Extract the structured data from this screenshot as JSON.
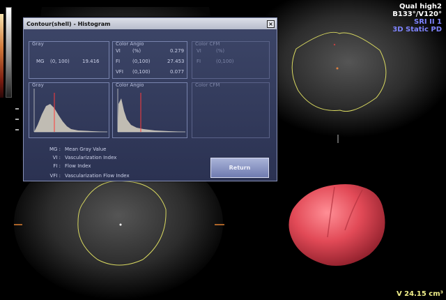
{
  "dialog": {
    "title": "Contour(shell) - Histogram",
    "close_label": "×",
    "gray_panel": {
      "title": "Gray",
      "mg_label": "MG",
      "mg_range": "(0, 100)",
      "mg_value": "19.416"
    },
    "angio_panel": {
      "title": "Color Angio",
      "vi_label": "VI",
      "vi_range": "(%)",
      "vi_value": "0.279",
      "fi_label": "FI",
      "fi_range": "(0,100)",
      "fi_value": "27.453",
      "vfi_label": "VFI",
      "vfi_range": "(0,100)",
      "vfi_value": "0.077"
    },
    "cfm_panel": {
      "title": "Color CFM",
      "vi_label": "VI",
      "vi_range": "(%)",
      "fi_label": "FI",
      "fi_range": "(0,100)"
    },
    "hist_gray_title": "Gray",
    "hist_angio_title": "Color Angio",
    "hist_cfm_title": "Color CFM",
    "legend": [
      {
        "key": "MG :",
        "text": "Mean Gray Value"
      },
      {
        "key": "VI :",
        "text": "Vascularization Index"
      },
      {
        "key": "FI :",
        "text": "Flow Index"
      },
      {
        "key": "VFI :",
        "text": "Vascularization Flow Index"
      }
    ],
    "return_label": "Return"
  },
  "info": {
    "line1": "Qual high2",
    "line2": "B133°/V120°",
    "line3": "SRI II 1",
    "line4": "3D Static PD"
  },
  "volume": "V 24.15 cm³",
  "colors": {
    "contour": "#d8d860",
    "render": "#e8505c",
    "dialog_bg": "#323a5c",
    "info_blue": "#7f84ff"
  }
}
